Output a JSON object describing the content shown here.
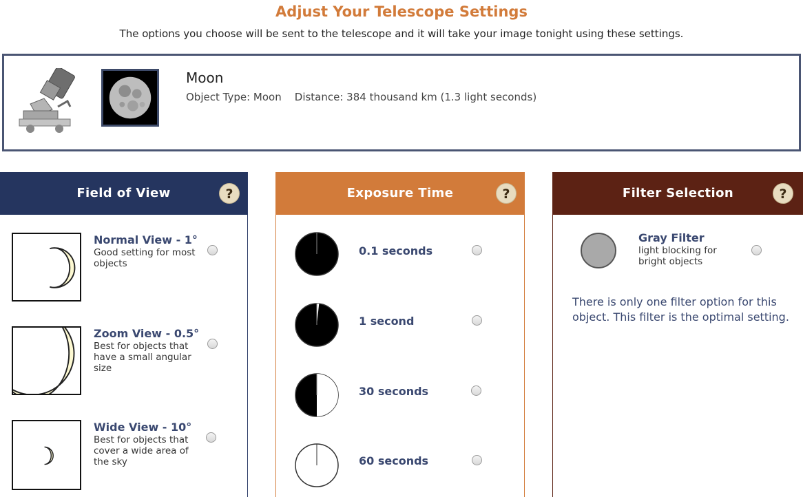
{
  "header": {
    "title": "Adjust Your Telescope Settings",
    "subtitle": "The options you choose will be sent to the telescope and it will take your image tonight using these settings."
  },
  "object": {
    "name": "Moon",
    "meta": "Object Type: Moon    Distance: 384 thousand km (1.3 light seconds)"
  },
  "panels": {
    "fov": {
      "title": "Field of View",
      "help": "?",
      "options": [
        {
          "title": "Normal View - 1°",
          "desc": "Good setting for most objects"
        },
        {
          "title": "Zoom View - 0.5°",
          "desc": "Best for objects that have a small angular size"
        },
        {
          "title": "Wide View - 10°",
          "desc": "Best for objects that cover a wide area of the sky"
        }
      ]
    },
    "exposure": {
      "title": "Exposure Time",
      "help": "?",
      "options": [
        {
          "label": "0.1 seconds",
          "fraction": 0.002
        },
        {
          "label": "1 second",
          "fraction": 0.017
        },
        {
          "label": "30 seconds",
          "fraction": 0.5
        },
        {
          "label": "60 seconds",
          "fraction": 1.0
        }
      ]
    },
    "filter": {
      "title": "Filter Selection",
      "help": "?",
      "option": {
        "title": "Gray Filter",
        "desc": "light blocking for bright objects",
        "color": "#a9a9a9"
      },
      "note": "There is only one filter option for this object. This filter is the optimal setting."
    }
  },
  "colors": {
    "accent": "#d27b3a",
    "fov_header": "#25355f",
    "exposure_header": "#d27b3a",
    "filter_header": "#5c2214",
    "moon_fill": "#fdf9d2"
  }
}
